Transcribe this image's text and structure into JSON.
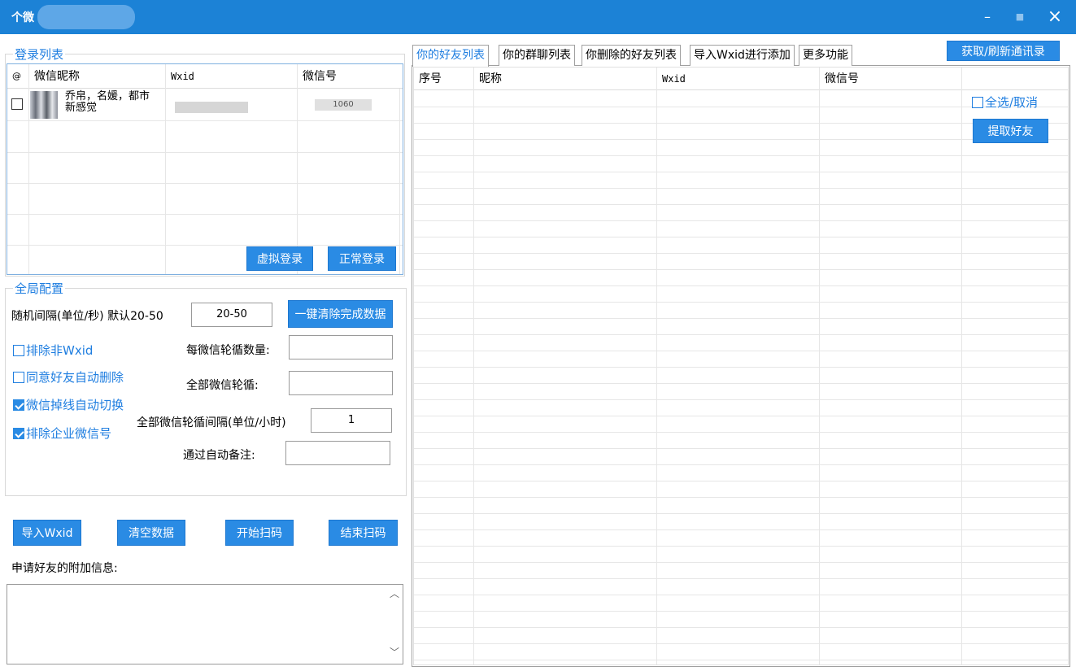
{
  "window": {
    "title": "个微"
  },
  "login_list": {
    "title": "登录列表",
    "columns": [
      "@",
      "微信昵称",
      "Wxid",
      "微信号"
    ],
    "rows": [
      {
        "nickname": "乔帛，名媛，都市新感觉",
        "wxid_partial": "",
        "wechat_id_partial": "1060"
      }
    ],
    "virtual_login_label": "虚拟登录",
    "normal_login_label": "正常登录"
  },
  "global_config": {
    "title": "全局配置",
    "interval_label": "随机间隔(单位/秒) 默认20-50",
    "interval_value": "20-50",
    "clear_done_label": "一键清除完成数据",
    "exclude_non_wxid": "排除非Wxid",
    "auto_delete_friend": "同意好友自动删除",
    "auto_switch_offline": "微信掉线自动切换",
    "exclude_enterprise": "排除企业微信号",
    "per_rotation_label": "每微信轮循数量:",
    "all_rotation_label": "全部微信轮循:",
    "rotation_interval_label": "全部微信轮循间隔(单位/小时)",
    "rotation_interval_value": "1",
    "auto_remark_label": "通过自动备注:",
    "per_rotation_value": "",
    "all_rotation_value": "",
    "auto_remark_value": ""
  },
  "actions": {
    "import_wxid": "导入Wxid",
    "clear_data": "清空数据",
    "start_scan": "开始扫码",
    "end_scan": "结束扫码"
  },
  "extra_info": {
    "label": "申请好友的附加信息:",
    "value": ""
  },
  "tabs": [
    "你的好友列表",
    "你的群聊列表",
    "你删除的好友列表",
    "导入Wxid进行添加",
    "更多功能"
  ],
  "refresh_contacts_label": "获取/刷新通讯录",
  "friends_grid": {
    "columns": [
      "序号",
      "昵称",
      "Wxid",
      "微信号"
    ],
    "select_all_label": "全选/取消",
    "extract_label": "提取好友"
  },
  "colors": {
    "titlebar": "#1c82d6",
    "accent": "#1f7ee0",
    "button": "#2a8be4"
  }
}
